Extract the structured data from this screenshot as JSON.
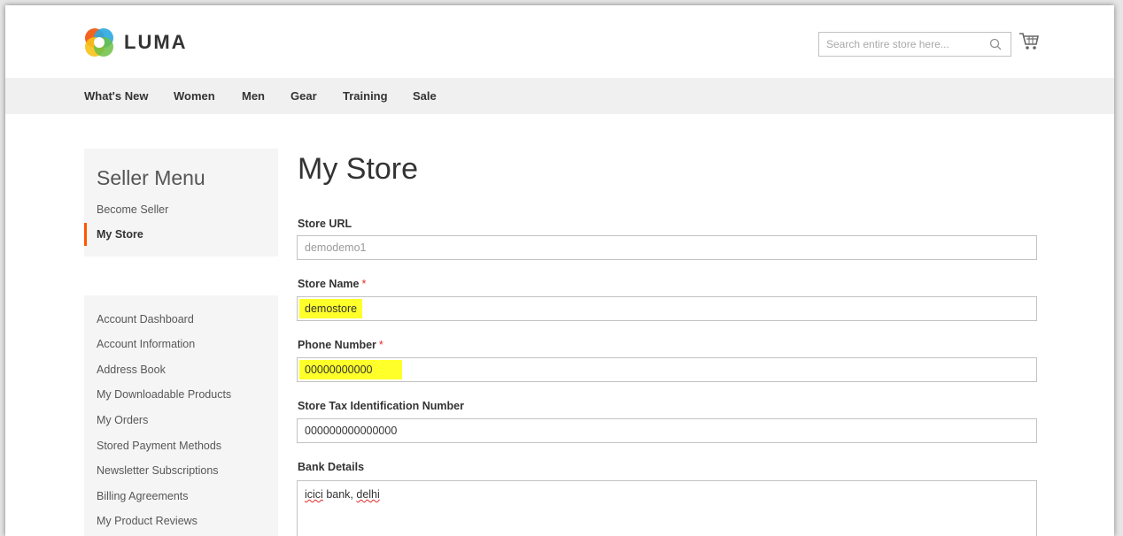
{
  "brand": {
    "name": "LUMA"
  },
  "search": {
    "placeholder": "Search entire store here..."
  },
  "nav": [
    "What's New",
    "Women",
    "Men",
    "Gear",
    "Training",
    "Sale"
  ],
  "seller_menu": {
    "title": "Seller Menu",
    "items": [
      "Become Seller",
      "My Store"
    ],
    "active": "My Store"
  },
  "account_menu": {
    "items": [
      "Account Dashboard",
      "Account Information",
      "Address Book",
      "My Downloadable Products",
      "My Orders",
      "Stored Payment Methods",
      "Newsletter Subscriptions",
      "Billing Agreements",
      "My Product Reviews"
    ]
  },
  "page": {
    "title": "My Store"
  },
  "form": {
    "store_url": {
      "label": "Store URL",
      "value": "demodemo1"
    },
    "store_name": {
      "label": "Store Name",
      "required": "*",
      "value": "demostore"
    },
    "phone": {
      "label": "Phone Number",
      "required": "*",
      "value": "00000000000"
    },
    "tax_id": {
      "label": "Store Tax Identification Number",
      "value": "000000000000000"
    },
    "bank": {
      "label": "Bank Details",
      "value_part1": "icici",
      "value_part2": " bank, ",
      "value_part3": "delhi"
    }
  },
  "colors": {
    "accent": "#ff5501",
    "highlight": "#ffff29",
    "nav_bg": "#f0f0f0",
    "required": "#e02b27"
  },
  "icons": {
    "search": "search-icon",
    "cart": "cart-icon",
    "logo": "luma-logo-icon"
  }
}
